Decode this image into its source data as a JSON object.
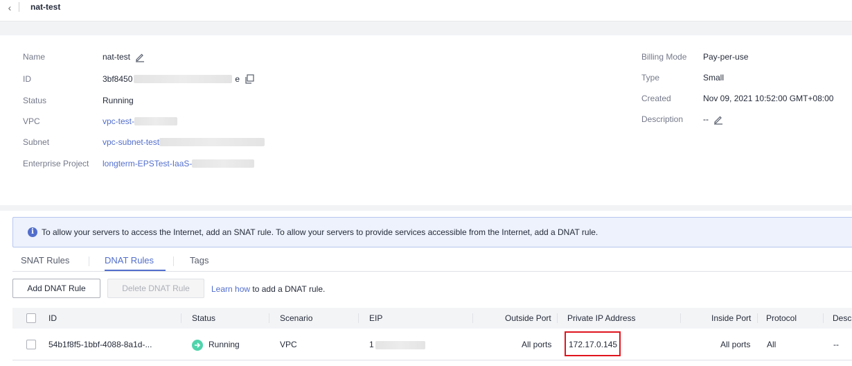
{
  "header": {
    "title": "nat-test"
  },
  "details": {
    "name_label": "Name",
    "name_value": "nat-test",
    "id_label": "ID",
    "id_prefix": "3bf8450",
    "id_suffix": "e",
    "status_label": "Status",
    "status_value": "Running",
    "vpc_label": "VPC",
    "vpc_value": "vpc-test-",
    "subnet_label": "Subnet",
    "subnet_value": "vpc-subnet-test",
    "project_label": "Enterprise Project",
    "project_value": "longterm-EPSTest-IaaS-",
    "billing_label": "Billing Mode",
    "billing_value": "Pay-per-use",
    "type_label": "Type",
    "type_value": "Small",
    "created_label": "Created",
    "created_value": "Nov 09, 2021 10:52:00 GMT+08:00",
    "desc_label": "Description",
    "desc_value": "--"
  },
  "alert": {
    "icon": "info-icon",
    "text": "To allow your servers to access the Internet, add an SNAT rule. To allow your servers to provide services accessible from the Internet, add a DNAT rule."
  },
  "tabs": [
    "SNAT Rules",
    "DNAT Rules",
    "Tags"
  ],
  "toolbar": {
    "add_label": "Add DNAT Rule",
    "delete_label": "Delete DNAT Rule",
    "learn_link": "Learn how",
    "learn_rest": "to add a DNAT rule."
  },
  "table": {
    "columns": [
      "ID",
      "Status",
      "Scenario",
      "EIP",
      "Outside Port",
      "Private IP Address",
      "Inside Port",
      "Protocol",
      "Descr"
    ],
    "rows": [
      {
        "id": "54b1f8f5-1bbf-4088-8a1d-...",
        "status": "Running",
        "scenario": "VPC",
        "eip": "1",
        "outside_port": "All ports",
        "private_ip": "172.17.0.145",
        "inside_port": "All ports",
        "protocol": "All",
        "description": "--"
      }
    ]
  },
  "colors": {
    "accent": "#526ecc",
    "running": "#50d4ab",
    "highlight": "#e0141e"
  }
}
